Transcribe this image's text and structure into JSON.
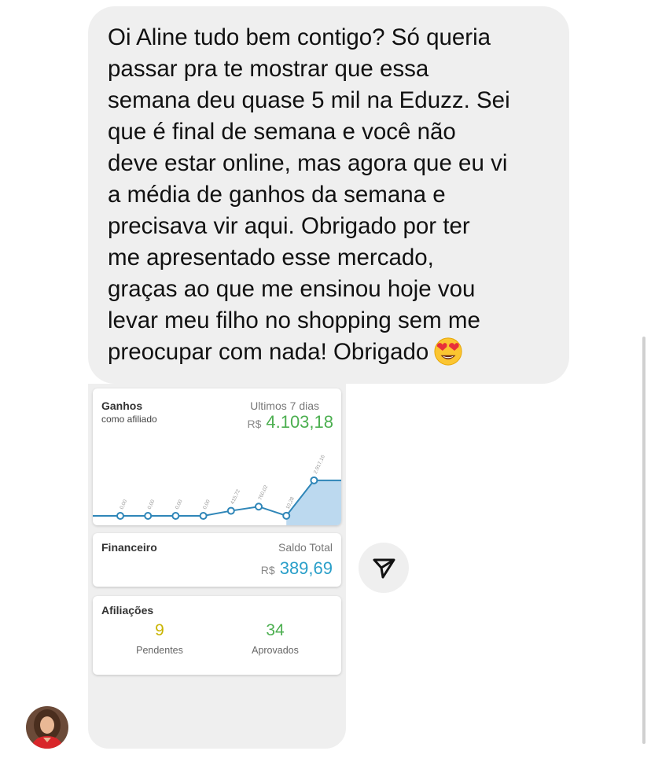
{
  "message": {
    "text": "Oi Aline tudo bem contigo? Só queria\npassar pra te mostrar que essa\nsemana deu quase 5 mil na Eduzz. Sei\nque é final de semana e você não\ndeve estar online, mas agora que eu vi\na média de ganhos da semana e\nprecisava vir aqui. Obrigado por ter\nme apresentado esse mercado,\ngraças ao que me ensinou hoje vou\nlevar meu filho no shopping sem me\npreocupar com nada! Obrigado",
    "emoji": "heart-eyes-emoji"
  },
  "ganhos": {
    "title": "Ganhos",
    "subtitle": "como afiliado",
    "period": "Ultimos 7 dias",
    "currency": "R$",
    "total": "4.103,18"
  },
  "chart_data": {
    "type": "area",
    "x": [
      1,
      2,
      3,
      4,
      5,
      6,
      7,
      8
    ],
    "values": [
      0.0,
      0.0,
      0.0,
      0.0,
      415.72,
      760.02,
      10.28,
      2917.16
    ],
    "data_labels": [
      "0,00",
      "0,00",
      "0,00",
      "0,00",
      "415,72",
      "760,02",
      "10,28",
      "2.917,16"
    ],
    "ylim": [
      0,
      3100
    ],
    "title": "",
    "xlabel": "",
    "ylabel": "",
    "grid": false,
    "line_color": "#2f86b8",
    "fill_color": "#bcd9ef"
  },
  "financeiro": {
    "title": "Financeiro",
    "label": "Saldo Total",
    "currency": "R$",
    "amount": "389,69"
  },
  "afiliacoes": {
    "title": "Afiliações",
    "pending_value": "9",
    "pending_label": "Pendentes",
    "approved_value": "34",
    "approved_label": "Aprovados"
  },
  "colors": {
    "green": "#4caf50",
    "blue": "#2a9fc9",
    "yellow": "#c9b400",
    "bubble": "#efefef"
  },
  "icons": {
    "send": "paper-plane-icon",
    "avatar": "user-avatar"
  }
}
